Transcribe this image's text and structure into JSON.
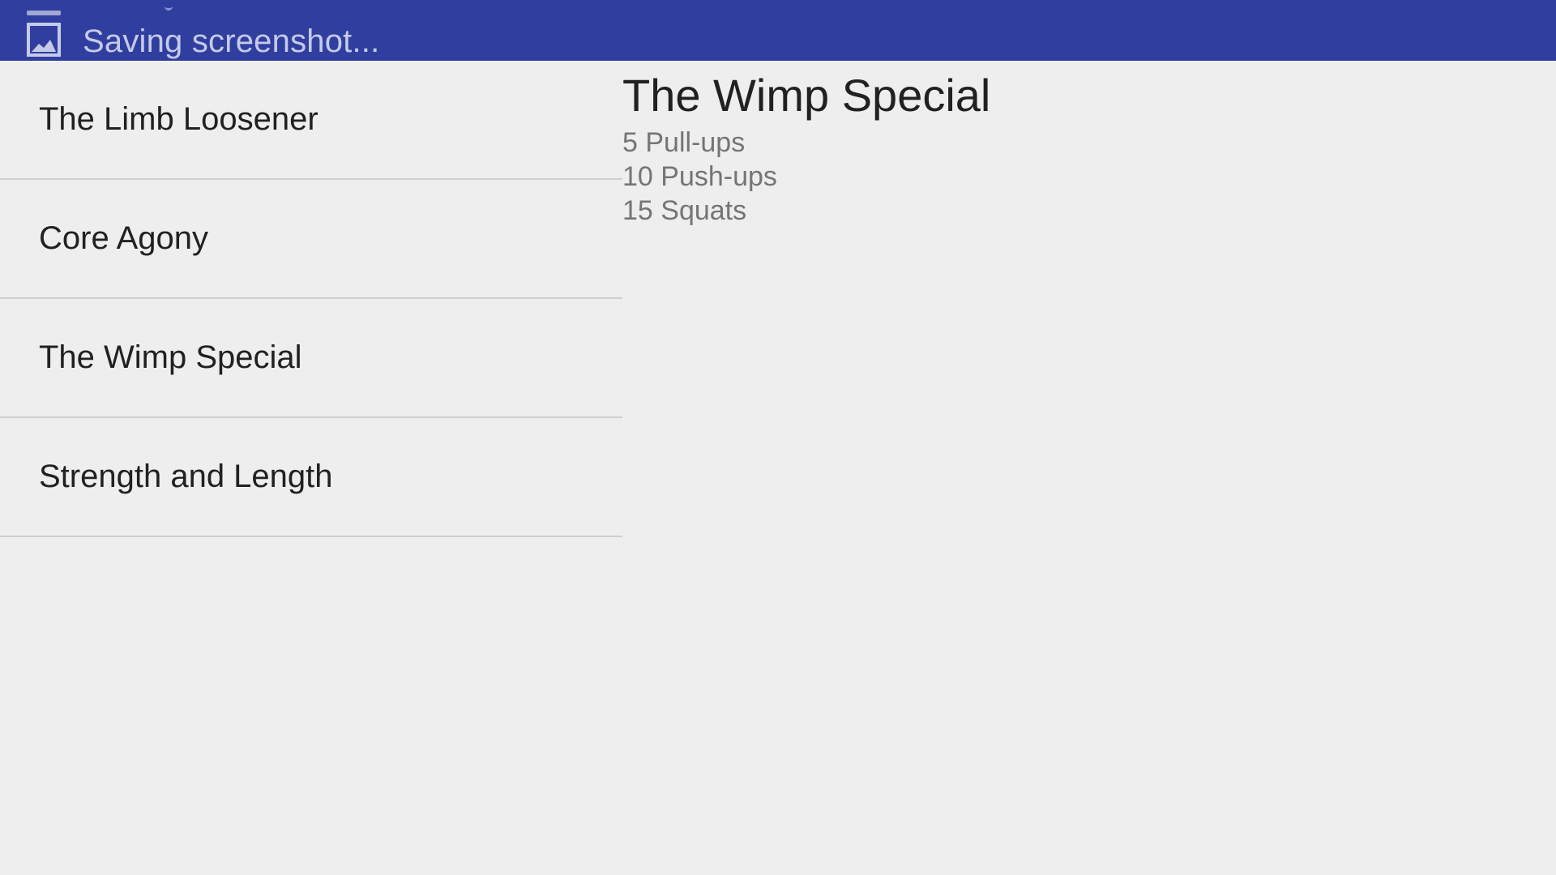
{
  "status_bar": {
    "notification_text": "Saving screenshot...",
    "icon": "screenshot-image-icon",
    "background_color": "#303f9f"
  },
  "workout_list": {
    "items": [
      {
        "label": "The Limb Loosener"
      },
      {
        "label": "Core Agony"
      },
      {
        "label": "The Wimp Special"
      },
      {
        "label": "Strength and Length"
      }
    ]
  },
  "workout_detail": {
    "title": "The Wimp Special",
    "exercises": [
      {
        "text": "5 Pull-ups"
      },
      {
        "text": "10 Push-ups"
      },
      {
        "text": "15 Squats"
      }
    ]
  }
}
